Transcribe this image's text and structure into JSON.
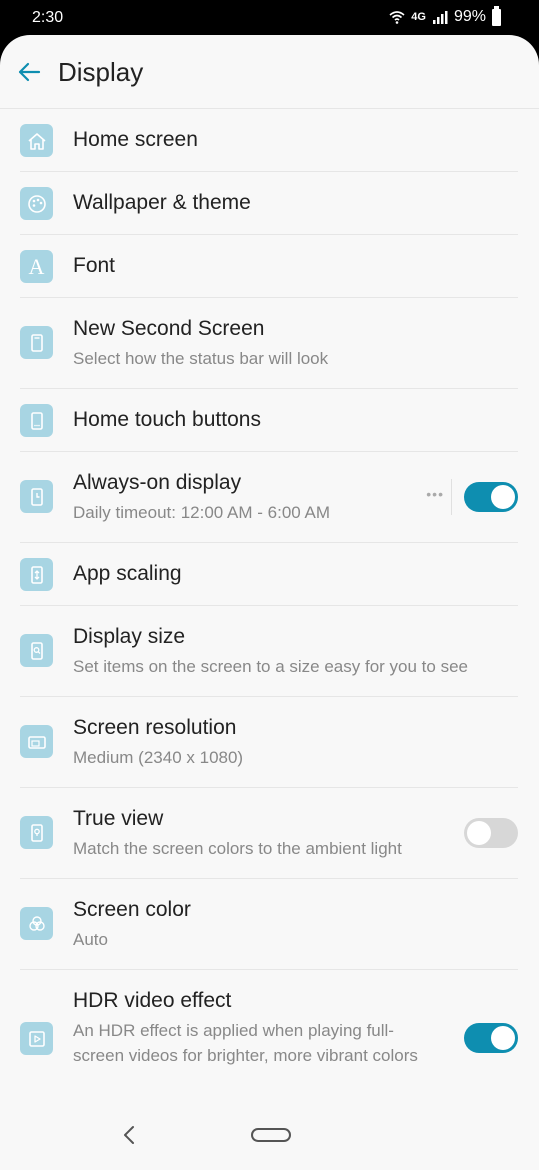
{
  "status_bar": {
    "time": "2:30",
    "network": "4G",
    "battery": "99%"
  },
  "header": {
    "title": "Display"
  },
  "items": [
    {
      "label": "Home screen",
      "icon": "home-icon"
    },
    {
      "label": "Wallpaper & theme",
      "icon": "palette-icon"
    },
    {
      "label": "Font",
      "icon": "font-icon"
    },
    {
      "label": "New Second Screen",
      "sub": "Select how the status bar will look",
      "icon": "phone-icon"
    },
    {
      "label": "Home touch buttons",
      "icon": "touch-buttons-icon"
    },
    {
      "label": "Always-on display",
      "sub": "Daily timeout: 12:00 AM - 6:00 AM",
      "icon": "clock-phone-icon",
      "toggle": true
    },
    {
      "label": "App scaling",
      "icon": "app-scaling-icon"
    },
    {
      "label": "Display size",
      "sub": "Set items on the screen to a size easy for you to see",
      "icon": "display-size-icon"
    },
    {
      "label": "Screen resolution",
      "sub": "Medium (2340 x 1080)",
      "icon": "resolution-icon"
    },
    {
      "label": "True view",
      "sub": "Match the screen colors to the ambient light",
      "icon": "bulb-phone-icon",
      "toggle": false
    },
    {
      "label": "Screen color",
      "sub": "Auto",
      "icon": "color-circles-icon"
    },
    {
      "label": "HDR video effect",
      "sub": "An HDR effect is applied when playing full-screen videos for brighter, more vibrant colors",
      "icon": "video-icon",
      "toggle": true
    }
  ],
  "colors": {
    "accent": "#0e8eb0",
    "icon_bg": "#a8d5e3"
  }
}
